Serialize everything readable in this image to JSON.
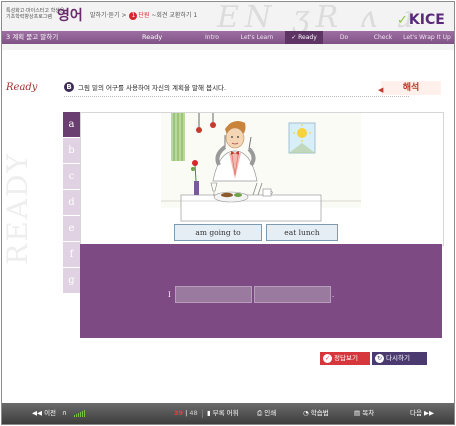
{
  "header": {
    "school_line1": "특성화고·마이스터고 학생용",
    "school_line2": "기초학력향상프로그램",
    "subject": "영어",
    "breadcrumb": {
      "section": "말하기·듣기",
      "sep": ">",
      "unit_number": "1",
      "unit_label": "단원",
      "lesson": "~회견 교환하기 1"
    },
    "logo_text": "KICE"
  },
  "navbar": {
    "unit_title": "3 계획 묻고 말하기",
    "section": "Ready",
    "tabs": [
      {
        "label": "Intro"
      },
      {
        "label": "Let's Learn"
      },
      {
        "label": "✓ Ready"
      },
      {
        "label": "Do"
      },
      {
        "label": "Check"
      },
      {
        "label": "Let's Wrap It Up"
      }
    ]
  },
  "activity": {
    "label": "Ready",
    "badge": "B",
    "instruction": "그림 밑의 어구를 사용하여 자신의 계획을 말해 봅시다.",
    "translate_button": "해석",
    "tabs": [
      "a",
      "b",
      "c",
      "d",
      "e",
      "f",
      "g"
    ],
    "active_tab": "a",
    "chips": [
      "am going to",
      "eat lunch"
    ],
    "answer_prefix": "I",
    "answer_suffix": ".",
    "background_word": "READY"
  },
  "buttons": {
    "show_answer": "정답보기",
    "retry": "다시하기"
  },
  "footer": {
    "prev": "◀◀ 이전",
    "headphones": "∩",
    "page_current": "39",
    "page_total": "48",
    "appendix": "부록 어휘",
    "print": "인쇄",
    "study_plan": "학습법",
    "toc": "목차",
    "next": "다음 ▶▶"
  },
  "colors": {
    "brand_purple": "#7d4a84",
    "accent_red": "#d6373d",
    "retry_navy": "#4a3a70"
  }
}
